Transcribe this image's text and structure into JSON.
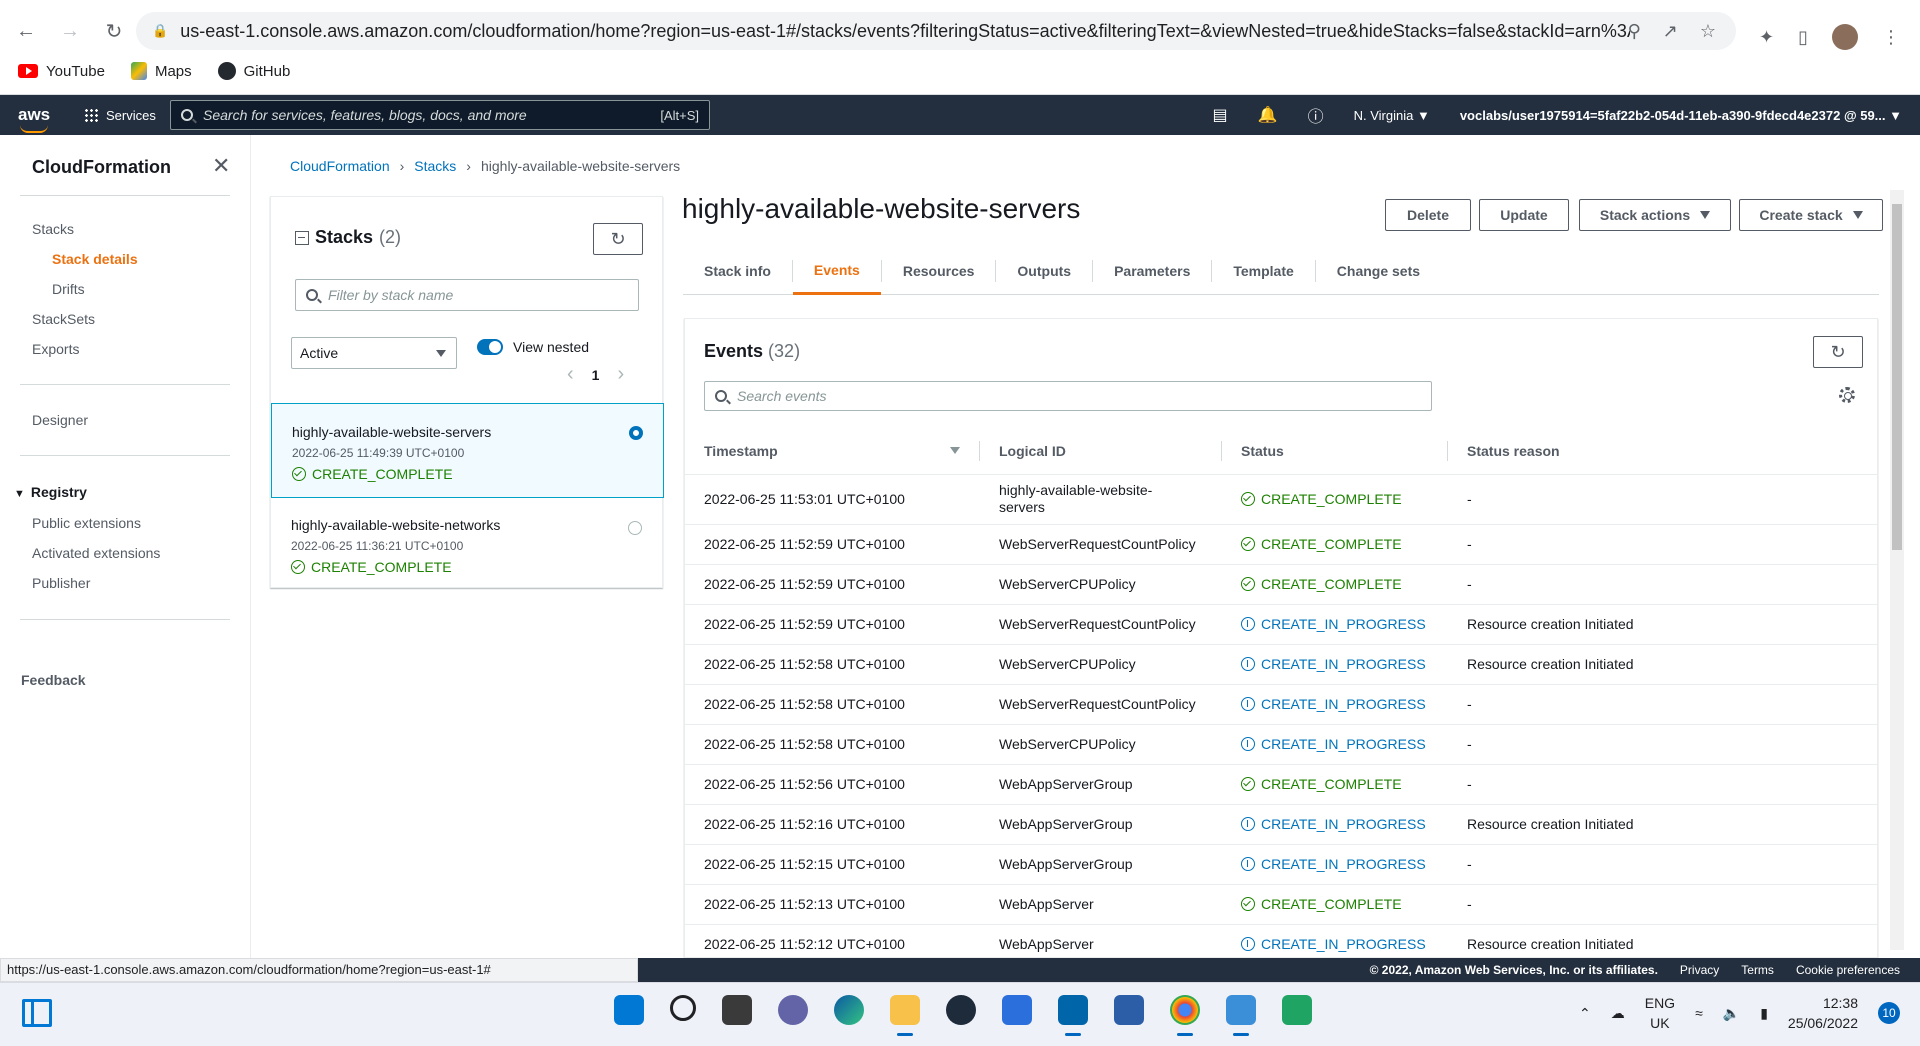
{
  "browser": {
    "url": "us-east-1.console.aws.amazon.com/cloudformation/home?region=us-east-1#/stacks/events?filteringStatus=active&filteringText=&viewNested=true&hideStacks=false&stackId=arn%3A...",
    "bookmarks": [
      "YouTube",
      "Maps",
      "GitHub"
    ]
  },
  "aws_header": {
    "services_label": "Services",
    "search_placeholder": "Search for services, features, blogs, docs, and more",
    "search_shortcut": "[Alt+S]",
    "region": "N. Virginia ▼",
    "account": "voclabs/user1975914=5faf22b2-054d-11eb-a390-9fdecd4e2372 @ 59... ▼"
  },
  "sidebar": {
    "title": "CloudFormation",
    "items": [
      "Stacks",
      "Stack details",
      "Drifts",
      "StackSets",
      "Exports",
      "Designer"
    ],
    "registry": {
      "label": "Registry",
      "items": [
        "Public extensions",
        "Activated extensions",
        "Publisher"
      ]
    },
    "feedback": "Feedback"
  },
  "breadcrumb": [
    "CloudFormation",
    "Stacks",
    "highly-available-website-servers"
  ],
  "stacks_panel": {
    "title": "Stacks",
    "count": "(2)",
    "filter_placeholder": "Filter by stack name",
    "status_filter": "Active",
    "view_nested_label": "View nested",
    "page": "1",
    "stacks": [
      {
        "name": "highly-available-website-servers",
        "timestamp": "2022-06-25 11:49:39 UTC+0100",
        "status": "CREATE_COMPLETE",
        "selected": true
      },
      {
        "name": "highly-available-website-networks",
        "timestamp": "2022-06-25 11:36:21 UTC+0100",
        "status": "CREATE_COMPLETE",
        "selected": false
      }
    ]
  },
  "stack_detail": {
    "title": "highly-available-website-servers",
    "buttons": [
      "Delete",
      "Update",
      "Stack actions",
      "Create stack"
    ],
    "tabs": [
      "Stack info",
      "Events",
      "Resources",
      "Outputs",
      "Parameters",
      "Template",
      "Change sets"
    ],
    "active_tab": "Events"
  },
  "events": {
    "title": "Events",
    "count": "(32)",
    "search_placeholder": "Search events",
    "columns": [
      "Timestamp",
      "Logical ID",
      "Status",
      "Status reason"
    ],
    "rows": [
      {
        "timestamp": "2022-06-25 11:53:01 UTC+0100",
        "logical_id": "highly-available-website-servers",
        "status": "CREATE_COMPLETE",
        "kind": "ok",
        "reason": "-"
      },
      {
        "timestamp": "2022-06-25 11:52:59 UTC+0100",
        "logical_id": "WebServerRequestCountPolicy",
        "status": "CREATE_COMPLETE",
        "kind": "ok",
        "reason": "-"
      },
      {
        "timestamp": "2022-06-25 11:52:59 UTC+0100",
        "logical_id": "WebServerCPUPolicy",
        "status": "CREATE_COMPLETE",
        "kind": "ok",
        "reason": "-"
      },
      {
        "timestamp": "2022-06-25 11:52:59 UTC+0100",
        "logical_id": "WebServerRequestCountPolicy",
        "status": "CREATE_IN_PROGRESS",
        "kind": "prog",
        "reason": "Resource creation Initiated"
      },
      {
        "timestamp": "2022-06-25 11:52:58 UTC+0100",
        "logical_id": "WebServerCPUPolicy",
        "status": "CREATE_IN_PROGRESS",
        "kind": "prog",
        "reason": "Resource creation Initiated"
      },
      {
        "timestamp": "2022-06-25 11:52:58 UTC+0100",
        "logical_id": "WebServerRequestCountPolicy",
        "status": "CREATE_IN_PROGRESS",
        "kind": "prog",
        "reason": "-"
      },
      {
        "timestamp": "2022-06-25 11:52:58 UTC+0100",
        "logical_id": "WebServerCPUPolicy",
        "status": "CREATE_IN_PROGRESS",
        "kind": "prog",
        "reason": "-"
      },
      {
        "timestamp": "2022-06-25 11:52:56 UTC+0100",
        "logical_id": "WebAppServerGroup",
        "status": "CREATE_COMPLETE",
        "kind": "ok",
        "reason": "-"
      },
      {
        "timestamp": "2022-06-25 11:52:16 UTC+0100",
        "logical_id": "WebAppServerGroup",
        "status": "CREATE_IN_PROGRESS",
        "kind": "prog",
        "reason": "Resource creation Initiated"
      },
      {
        "timestamp": "2022-06-25 11:52:15 UTC+0100",
        "logical_id": "WebAppServerGroup",
        "status": "CREATE_IN_PROGRESS",
        "kind": "prog",
        "reason": "-"
      },
      {
        "timestamp": "2022-06-25 11:52:13 UTC+0100",
        "logical_id": "WebAppServer",
        "status": "CREATE_COMPLETE",
        "kind": "ok",
        "reason": "-"
      },
      {
        "timestamp": "2022-06-25 11:52:12 UTC+0100",
        "logical_id": "WebAppServer",
        "status": "CREATE_IN_PROGRESS",
        "kind": "prog",
        "reason": "Resource creation Initiated"
      }
    ]
  },
  "footer": {
    "status_url": "https://us-east-1.console.aws.amazon.com/cloudformation/home?region=us-east-1#",
    "copyright": "© 2022, Amazon Web Services, Inc. or its affiliates.",
    "links": [
      "Privacy",
      "Terms",
      "Cookie preferences"
    ]
  },
  "taskbar": {
    "lang_top": "ENG",
    "lang_bottom": "UK",
    "time": "12:38",
    "date": "25/06/2022",
    "notifications": "10"
  },
  "colors": {
    "aws_nav": "#232f3e",
    "accent_orange": "#ec7211",
    "link_blue": "#0073bb",
    "success_green": "#1d8102"
  }
}
